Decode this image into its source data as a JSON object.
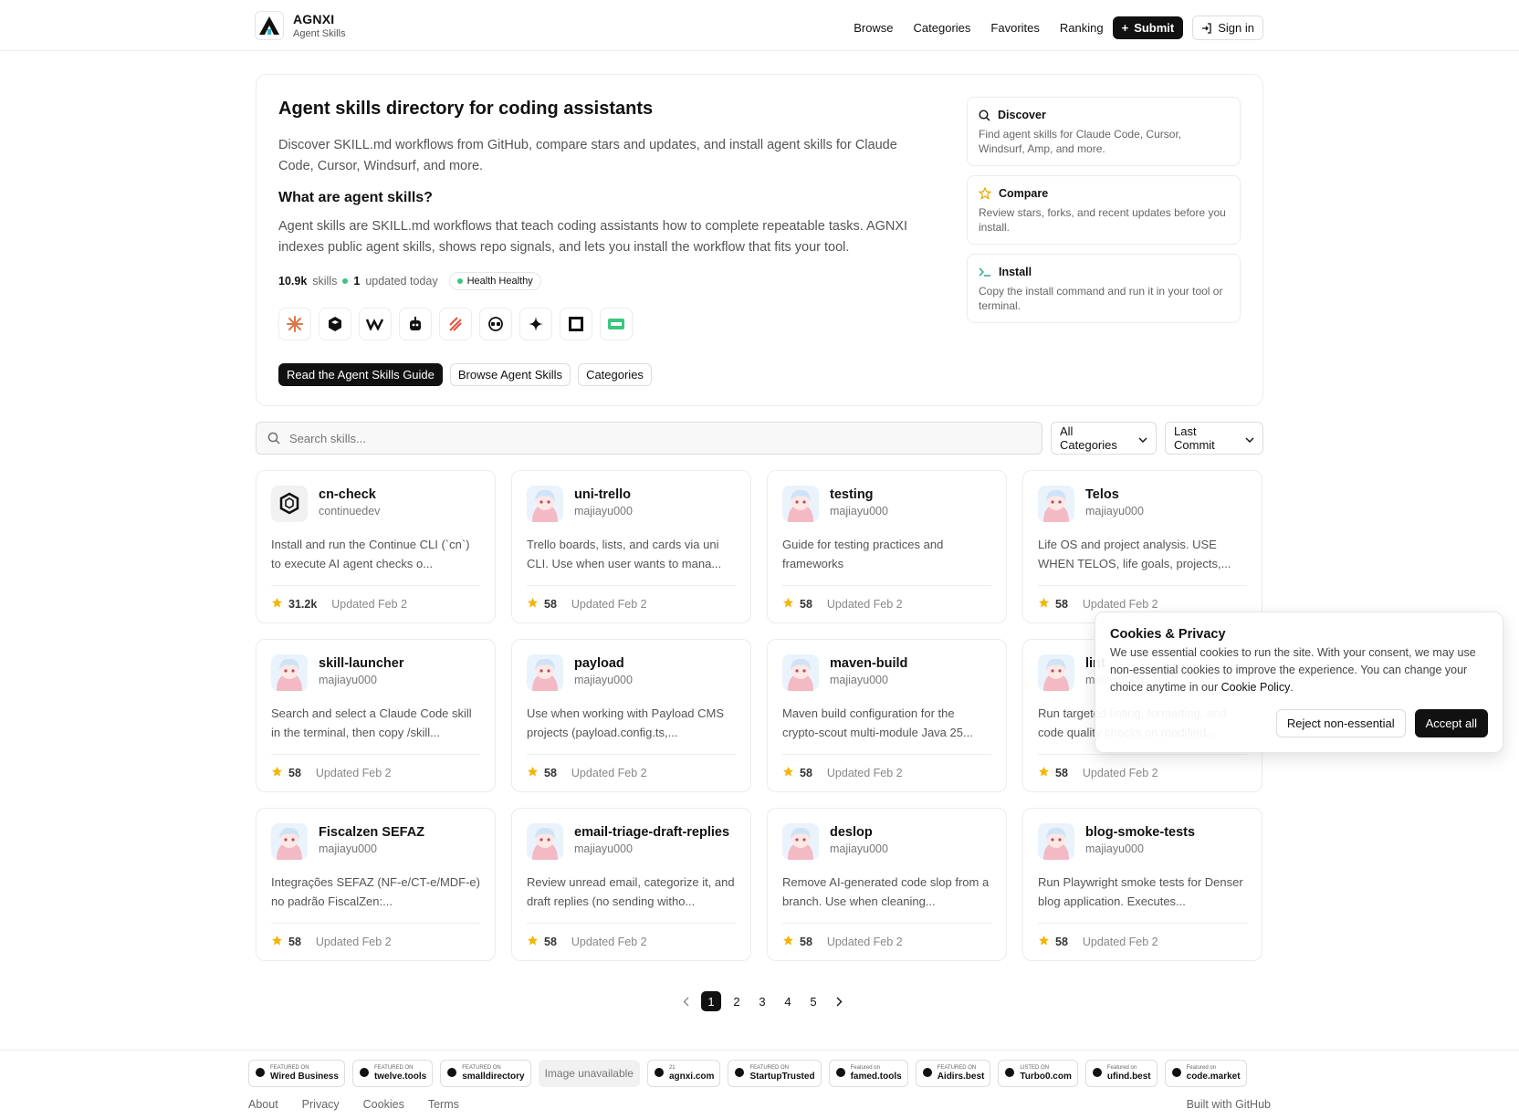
{
  "header": {
    "brand_name": "AGNXI",
    "brand_sub": "Agent Skills",
    "nav": [
      "Browse",
      "Categories",
      "Favorites",
      "Ranking"
    ],
    "submit_label": "Submit",
    "signin_label": "Sign in"
  },
  "hero": {
    "title": "Agent skills directory for coding assistants",
    "intro": "Discover SKILL.md workflows from GitHub, compare stars and updates, and install agent skills for Claude Code, Cursor, Windsurf, and more.",
    "subtitle": "What are agent skills?",
    "description": "Agent skills are SKILL.md workflows that teach coding assistants how to complete repeatable tasks. AGNXI indexes public agent skills, shows repo signals, and lets you install the workflow that fits your tool.",
    "stats": {
      "skills_count": "10.9k",
      "skills_label": "skills",
      "updated_count": "1",
      "updated_label": "updated today",
      "health_label": "Health Healthy"
    },
    "buttons": {
      "guide": "Read the Agent Skills Guide",
      "browse": "Browse Agent Skills",
      "categories": "Categories"
    },
    "features": [
      {
        "title": "Discover",
        "desc": "Find agent skills for Claude Code, Cursor, Windsurf, Amp, and more.",
        "icon": "search-icon"
      },
      {
        "title": "Compare",
        "desc": "Review stars, forks, and recent updates before you install.",
        "icon": "star-icon"
      },
      {
        "title": "Install",
        "desc": "Copy the install command and run it in your tool or terminal.",
        "icon": "terminal-icon"
      }
    ]
  },
  "search": {
    "placeholder": "Search skills...",
    "category_select": "All Categories",
    "sort_select": "Last Commit"
  },
  "skills": [
    {
      "name": "cn-check",
      "author": "continuedev",
      "desc": "Install and run the Continue CLI (`cn`) to execute AI agent checks o...",
      "stars": "31.2k",
      "updated": "Updated Feb 2"
    },
    {
      "name": "uni-trello",
      "author": "majiayu000",
      "desc": "Trello boards, lists, and cards via uni CLI. Use when user wants to mana...",
      "stars": "58",
      "updated": "Updated Feb 2"
    },
    {
      "name": "testing",
      "author": "majiayu000",
      "desc": "Guide for testing practices and frameworks",
      "stars": "58",
      "updated": "Updated Feb 2"
    },
    {
      "name": "Telos",
      "author": "majiayu000",
      "desc": "Life OS and project analysis. USE WHEN TELOS, life goals, projects,...",
      "stars": "58",
      "updated": "Updated Feb 2"
    },
    {
      "name": "skill-launcher",
      "author": "majiayu000",
      "desc": "Search and select a Claude Code skill in the terminal, then copy /skill...",
      "stars": "58",
      "updated": "Updated Feb 2"
    },
    {
      "name": "payload",
      "author": "majiayu000",
      "desc": "Use when working with Payload CMS projects (payload.config.ts,...",
      "stars": "58",
      "updated": "Updated Feb 2"
    },
    {
      "name": "maven-build",
      "author": "majiayu000",
      "desc": "Maven build configuration for the crypto-scout multi-module Java 25...",
      "stars": "58",
      "updated": "Updated Feb 2"
    },
    {
      "name": "lint",
      "author": "majiayu000",
      "desc": "Run targeted linting, formatting, and code quality checks on modified...",
      "stars": "58",
      "updated": "Updated Feb 2"
    },
    {
      "name": "Fiscalzen SEFAZ",
      "author": "majiayu000",
      "desc": "Integrações SEFAZ (NF-e/CT-e/MDF-e) no padrão FiscalZen:...",
      "stars": "58",
      "updated": "Updated Feb 2"
    },
    {
      "name": "email-triage-draft-replies",
      "author": "majiayu000",
      "desc": "Review unread email, categorize it, and draft replies (no sending witho...",
      "stars": "58",
      "updated": "Updated Feb 2"
    },
    {
      "name": "deslop",
      "author": "majiayu000",
      "desc": "Remove AI-generated code slop from a branch. Use when cleaning...",
      "stars": "58",
      "updated": "Updated Feb 2"
    },
    {
      "name": "blog-smoke-tests",
      "author": "majiayu000",
      "desc": "Run Playwright smoke tests for Denser blog application. Executes...",
      "stars": "58",
      "updated": "Updated Feb 2"
    }
  ],
  "pagination": {
    "pages": [
      "1",
      "2",
      "3",
      "4",
      "5"
    ],
    "current": "1"
  },
  "cookie": {
    "title": "Cookies & Privacy",
    "text": "We use essential cookies to run the site. With your consent, we may use non-essential cookies to improve the experience. You can change your choice anytime in our ",
    "link": "Cookie Policy",
    "reject": "Reject non-essential",
    "accept": "Accept all"
  },
  "footer": {
    "badges": [
      {
        "top": "FEATURED ON",
        "main": "Wired Business"
      },
      {
        "top": "FEATURED ON",
        "main": "twelve.tools"
      },
      {
        "top": "FEATURED ON",
        "main": "smalldirectory"
      },
      {
        "top": "",
        "main": "Image unavailable"
      },
      {
        "top": "21",
        "main": "agnxi.com"
      },
      {
        "top": "FEATURED ON",
        "main": "StartupTrusted"
      },
      {
        "top": "Featured on",
        "main": "famed.tools"
      },
      {
        "top": "FEATURED ON",
        "main": "Aidirs.best"
      },
      {
        "top": "LISTED ON",
        "main": "Turbo0.com"
      },
      {
        "top": "Featured on",
        "main": "ufind.best"
      },
      {
        "top": "Featured on",
        "main": "code.market"
      }
    ],
    "links": [
      "About",
      "Privacy",
      "Cookies",
      "Terms"
    ],
    "built_with": "Built with GitHub"
  },
  "colors": {
    "accent": "#111111",
    "star": "#f5b400",
    "health_dot": "#3cc47c"
  }
}
